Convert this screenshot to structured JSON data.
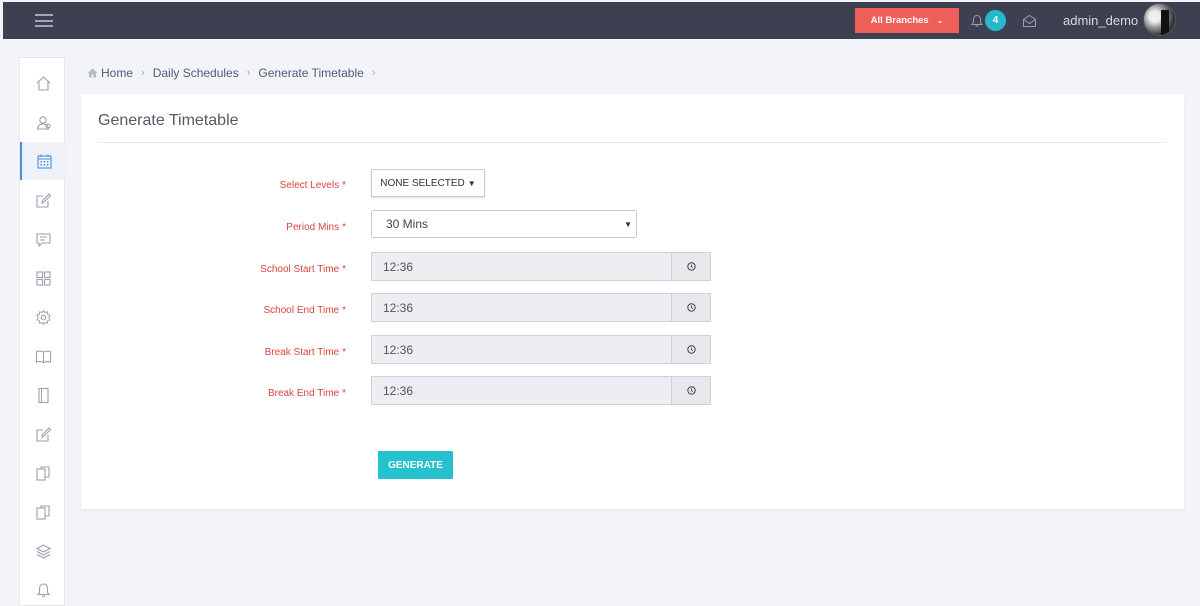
{
  "topbar": {
    "branch_label": "All Branches",
    "notification_count": "4",
    "username": "admin_demo"
  },
  "breadcrumb": {
    "items": [
      "Home",
      "Daily Schedules",
      "Generate Timetable"
    ]
  },
  "panel": {
    "title": "Generate Timetable"
  },
  "form": {
    "levels": {
      "label": "Select Levels",
      "value": "NONE SELECTED"
    },
    "period": {
      "label": "Period Mins",
      "value": "30 Mins"
    },
    "school_start": {
      "label": "School Start Time",
      "value": "12:36"
    },
    "school_end": {
      "label": "School End Time",
      "value": "12:36"
    },
    "break_start": {
      "label": "Break Start Time",
      "value": "12:36"
    },
    "break_end": {
      "label": "Break End Time",
      "value": "12:36"
    },
    "required_mark": "*",
    "submit_label": "GENERATE"
  },
  "colors": {
    "topbar": "#3d4050",
    "branch_button": "#f0605a",
    "badge": "#26b7c9",
    "label_required": "#d9443d",
    "generate_button": "#26c1cf"
  },
  "sidebar_icons": [
    "home-icon",
    "users-icon",
    "calendar-icon",
    "edit-icon",
    "message-icon",
    "grid-icon",
    "gear-icon",
    "book-icon",
    "notebook-icon",
    "edit-icon",
    "copy-icon",
    "copy-icon",
    "layers-icon",
    "bell-icon"
  ]
}
